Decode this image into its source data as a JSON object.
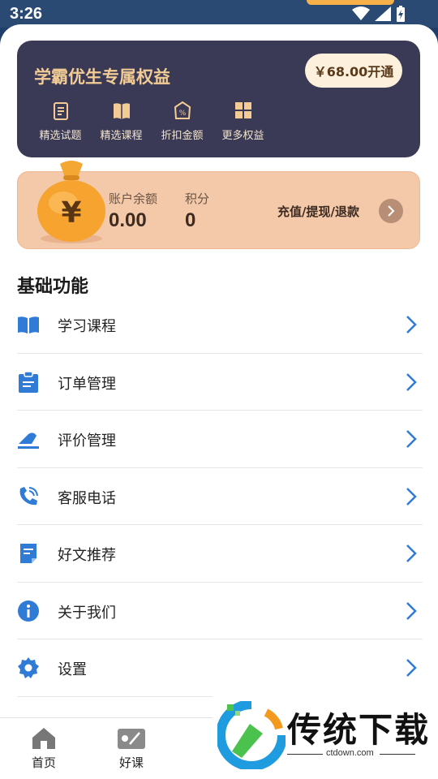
{
  "status_bar": {
    "time": "3:26"
  },
  "vip_card": {
    "title": "学霸优生专属权益",
    "open_button": "￥68.00开通",
    "perks": [
      {
        "label": "精选试题",
        "icon": "exam-paper-icon"
      },
      {
        "label": "精选课程",
        "icon": "book-icon"
      },
      {
        "label": "折扣金额",
        "icon": "discount-tag-icon"
      },
      {
        "label": "更多权益",
        "icon": "grid-icon"
      }
    ]
  },
  "wallet": {
    "balance_label": "账户余额",
    "balance_value": "0.00",
    "points_label": "积分",
    "points_value": "0",
    "action_label": "充值/提现/退款",
    "currency_symbol": "¥"
  },
  "section_title": "基础功能",
  "menu": [
    {
      "label": "学习课程",
      "icon": "book-open-icon"
    },
    {
      "label": "订单管理",
      "icon": "clipboard-icon"
    },
    {
      "label": "评价管理",
      "icon": "comment-icon"
    },
    {
      "label": "客服电话",
      "icon": "phone-icon"
    },
    {
      "label": "好文推荐",
      "icon": "document-icon"
    },
    {
      "label": "关于我们",
      "icon": "info-icon"
    },
    {
      "label": "设置",
      "icon": "gear-icon"
    }
  ],
  "tabs": [
    {
      "label": "首页",
      "icon": "home-icon"
    },
    {
      "label": "好课",
      "icon": "course-icon"
    }
  ],
  "watermark": {
    "text": "传统下载",
    "url": "ctdown.com"
  },
  "colors": {
    "accent_blue": "#2f7bd6",
    "vip_bg": "#3a3a57",
    "vip_gold": "#f2cc94",
    "wallet_bg": "#f3c9a9"
  }
}
